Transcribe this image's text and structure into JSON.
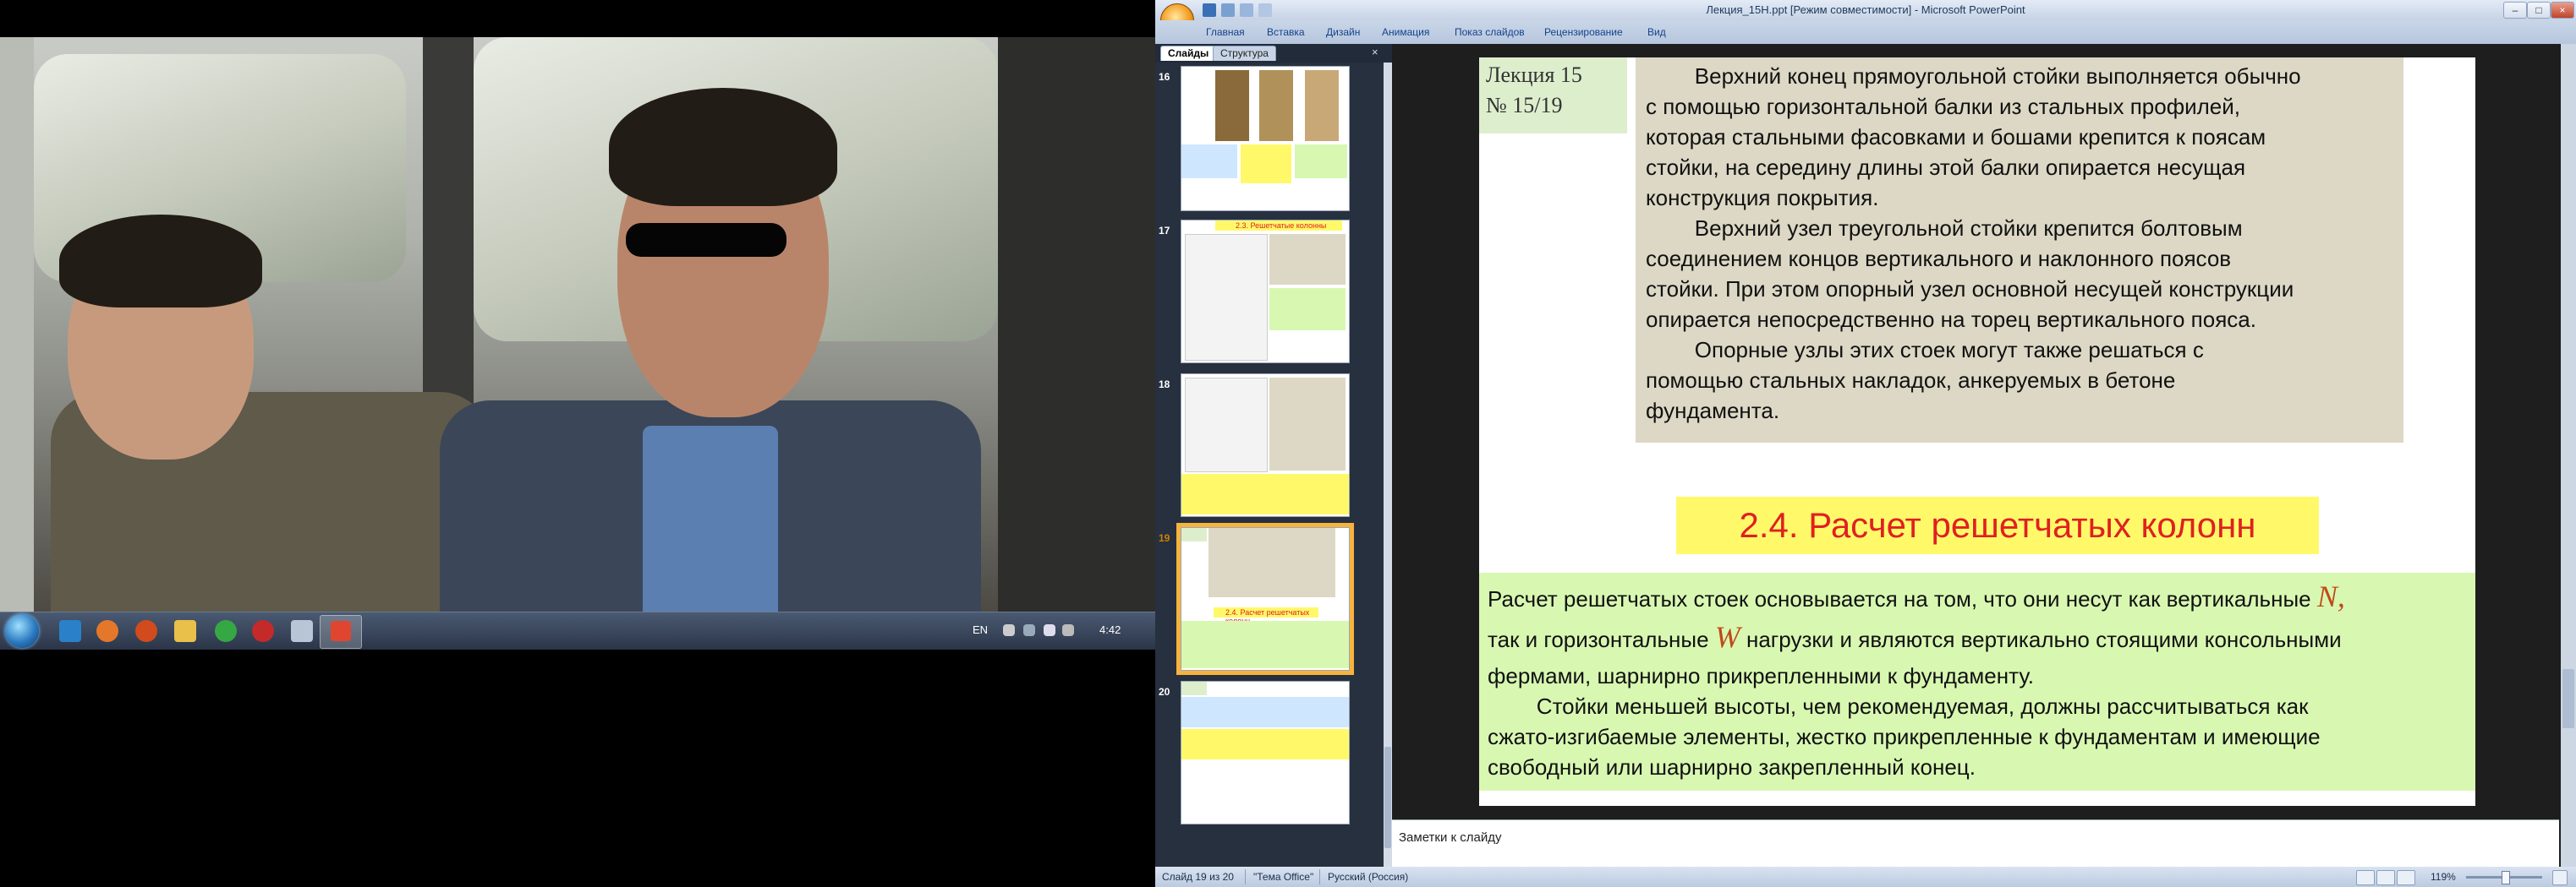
{
  "video_player": {
    "taskbar": {
      "lang": "EN",
      "clock": "4:42"
    }
  },
  "powerpoint": {
    "window_title": "Лекция_15Н.ppt [Режим совместимости] - Microsoft PowerPoint",
    "ribbon_tabs": [
      "Главная",
      "Вставка",
      "Дизайн",
      "Анимация",
      "Показ слайдов",
      "Рецензирование",
      "Вид"
    ],
    "panel_tabs": {
      "slides": "Слайды",
      "outline": "Структура"
    },
    "thumbnails": [
      {
        "number": "16",
        "title": ""
      },
      {
        "number": "17",
        "title": "2.3. Решетчатые колонны"
      },
      {
        "number": "18",
        "title": ""
      },
      {
        "number": "19",
        "title": "2.4. Расчет решетчатых колонн"
      },
      {
        "number": "20",
        "title": ""
      }
    ],
    "slide": {
      "lecture_line1": "Лекция 15",
      "lecture_line2": "№ 15/19",
      "grey_paragraphs": [
        "        Верхний конец прямоугольной стойки выполняется обычно",
        "с помощью горизонтальной балки из стальных профилей,",
        "которая стальными фасовками и бошами крепится к поясам",
        "стойки, на середину длины этой балки опирается несущая",
        "конструкция покрытия.",
        "        Верхний узел треугольной стойки крепится болтовым",
        "соединением концов вертикального и наклонного поясов",
        "стойки. При этом опорный узел основной несущей конструкции",
        "опирается непосредственно на торец вертикального пояса.",
        "        Опорные узлы этих стоек могут также решаться с",
        "помощью стальных накладок, анкеруемых в бетоне",
        "фундамента."
      ],
      "heading": "2.4. Расчет решетчатых колонн",
      "body_line1_a": "Расчет решетчатых стоек основывается на том, что они несут как вертикальные ",
      "symbol_N": "N,",
      "body_line2_a": "так и горизонтальные ",
      "symbol_W": "W",
      "body_line2_b": " нагрузки и являются вертикально стоящими консольными",
      "body_line3": "фермами, шарнирно прикрепленными к фундаменту.",
      "body_line4": "        Стойки меньшей высоты, чем рекомендуемая, должны рассчитываться как",
      "body_line5": "сжато-изгибаемые элементы, жестко прикрепленные к фундаментам и имеющие",
      "body_line6": "свободный или шарнирно закрепленный конец."
    },
    "notes_placeholder": "Заметки к слайду",
    "status": {
      "slide_counter": "Слайд 19 из 20",
      "theme": "\"Тема Office\"",
      "language": "Русский (Россия)",
      "zoom": "119%"
    },
    "colors": {
      "heading_red": "#e02020",
      "heading_bg": "#fff96a",
      "body_bg": "#d8f8b2",
      "grey_bg": "#dcd8c5"
    }
  }
}
